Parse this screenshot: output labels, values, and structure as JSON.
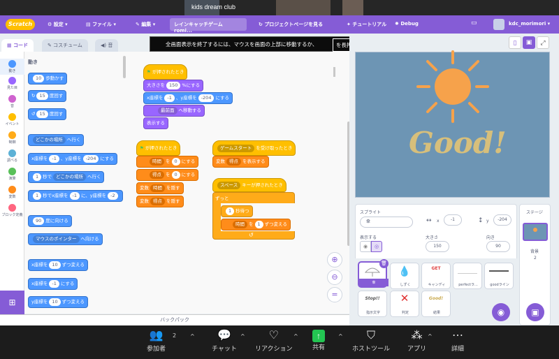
{
  "meeting_title": "kids dream club",
  "menubar": {
    "logo": "Scratch",
    "settings": "設定",
    "file": "ファイル",
    "edit": "編集",
    "project_title": "レインキャッチゲーム romi...",
    "project_page": "プロジェクトページを見る",
    "tutorials": "チュートリアル",
    "debug": "Debug",
    "username": "kdc_morimori"
  },
  "fullscreen_notice": {
    "message": "全画面表示を終了するには、マウスを画面の上部に移動するか、",
    "key": "を長押しします Esc"
  },
  "tabs": {
    "code": "コード",
    "costumes": "コスチューム",
    "sounds": "音"
  },
  "categories": [
    {
      "label": "動き",
      "color": "#4c97ff"
    },
    {
      "label": "見た目",
      "color": "#9966ff"
    },
    {
      "label": "音",
      "color": "#cf63cf"
    },
    {
      "label": "イベント",
      "color": "#ffbf00"
    },
    {
      "label": "制御",
      "color": "#ffab19"
    },
    {
      "label": "調べる",
      "color": "#5cb1d6"
    },
    {
      "label": "演算",
      "color": "#59c059"
    },
    {
      "label": "変数",
      "color": "#ff8c1a"
    },
    {
      "label": "ブロック定義",
      "color": "#ff6680"
    }
  ],
  "palette": {
    "heading": "動き",
    "move_val": "10",
    "move_txt": "歩動かす",
    "turnr_val": "15",
    "turnr_txt": "度回す",
    "turnl_val": "15",
    "turnl_txt": "度回す",
    "goto_dd": "どこかの場所",
    "goto_txt": "へ行く",
    "gotoxy_a": "x座標を",
    "gotoxy_x": "-1",
    "gotoxy_b": "、y座標を",
    "gotoxy_y": "-204",
    "gotoxy_c": "にする",
    "glide_val": "1",
    "glide_a": "秒で",
    "glide_dd": "どこかの場所",
    "glide_b": "へ行く",
    "glidexy_val": "1",
    "glidexy_a": "秒でx座標を",
    "glidexy_x": "-1",
    "glidexy_b": "に、y座標を",
    "glidexy_y": "-2",
    "point_val": "90",
    "point_txt": "度に向ける",
    "pointto_dd": "マウスのポインター",
    "pointto_txt": "へ向ける",
    "chx_a": "x座標を",
    "chx_val": "10",
    "chx_b": "ずつ変える",
    "setx_a": "x座標を",
    "setx_val": "-1",
    "setx_b": "にする",
    "chy_a": "y座標を",
    "chy_val": "10",
    "chy_b": "ずつ変える"
  },
  "scripts": {
    "s1_hat": "が押されたとき",
    "s1_size_a": "大きさを",
    "s1_size_val": "150",
    "s1_size_b": "%にする",
    "s1_xy_a": "x座標を",
    "s1_xy_x": "-1",
    "s1_xy_b": "、y座標を",
    "s1_xy_y": "-204",
    "s1_xy_c": "にする",
    "s1_layer_dd": "最前面",
    "s1_layer_txt": "へ移動する",
    "s1_show": "表示する",
    "s2_hat": "が押されたとき",
    "s2_set1_dd": "時間",
    "s2_set1_a": "を",
    "s2_set1_val": "0",
    "s2_set1_b": "にする",
    "s2_set2_dd": "得点",
    "s2_set2_a": "を",
    "s2_set2_val": "0",
    "s2_set2_b": "にする",
    "s2_hide1_a": "変数",
    "s2_hide1_dd": "時間",
    "s2_hide1_b": "を隠す",
    "s2_hide2_a": "変数",
    "s2_hide2_dd": "得点",
    "s2_hide2_b": "を隠す",
    "s3_hat_dd": "ゲームスタート",
    "s3_hat_txt": "を受け取ったとき",
    "s3_show_a": "変数",
    "s3_show_dd": "得点",
    "s3_show_b": "を表示する",
    "s4_hat_dd": "スペース",
    "s4_hat_txt": "キーが押されたとき",
    "s4_forever": "ずっと",
    "s4_wait_val": "1",
    "s4_wait_txt": "秒待つ",
    "s4_change_dd": "時間",
    "s4_change_a": "を",
    "s4_change_val": "1",
    "s4_change_b": "ずつ変える"
  },
  "backpack": "バックパック",
  "stage_text": "Good!",
  "sprite_info": {
    "sprite_label": "スプライト",
    "sprite_name": "傘",
    "x_label": "x",
    "x_val": "-1",
    "y_label": "y",
    "y_val": "-204",
    "show_label": "表示する",
    "size_label": "大きさ",
    "size_val": "150",
    "dir_label": "向き",
    "dir_val": "90"
  },
  "sprites": [
    {
      "name": "傘",
      "selected": true
    },
    {
      "name": "しずく",
      "selected": false
    },
    {
      "name": "キャンディ",
      "selected": false
    },
    {
      "name": "perfectラ...",
      "selected": false
    },
    {
      "name": "goodライン",
      "selected": false
    },
    {
      "name": "指示文字",
      "selected": false
    },
    {
      "name": "判定",
      "selected": false
    },
    {
      "name": "結果",
      "selected": false
    }
  ],
  "sprite_thumb_text": {
    "stop": "Stop!!",
    "good": "Good!",
    "candy": "GET"
  },
  "stage_panel": {
    "label": "ステージ",
    "backdrops_label": "背景",
    "backdrops_count": "2"
  },
  "zoom_toolbar": {
    "participants": "参加者",
    "participants_count": "2",
    "chat": "チャット",
    "reactions": "リアクション",
    "share": "共有",
    "host_tools": "ホストツール",
    "apps": "アプリ",
    "more": "詳細"
  }
}
